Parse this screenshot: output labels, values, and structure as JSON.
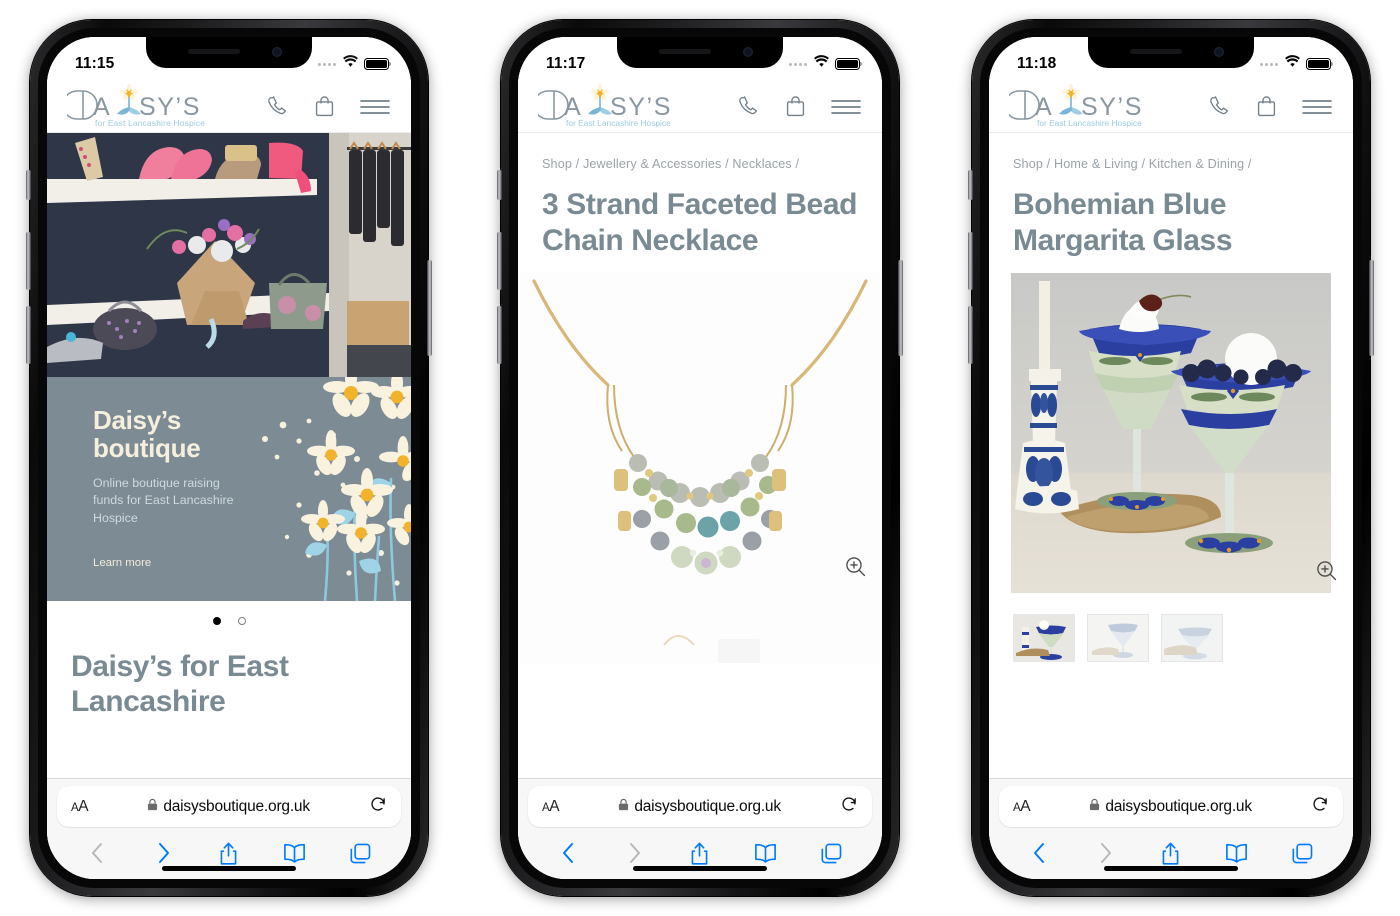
{
  "brand": {
    "logo_text": "DAISY'S",
    "logo_tagline": "for East Lancashire Hospice",
    "accent_slate": "#7c8b94",
    "accent_cream": "#f6efdd",
    "accent_blue": "#007aff",
    "logo_blue": "#79b6d6",
    "logo_gold": "#f2b225"
  },
  "phones": [
    {
      "id": "phone-home",
      "status": {
        "time": "11:15",
        "wifi": "wifi-icon",
        "battery": "battery-icon",
        "signal_dots": "signal-dots"
      },
      "header": {
        "icons": [
          "phone-icon",
          "shopping-bag-icon",
          "hamburger-menu-icon"
        ]
      },
      "hero_alt": "boutique-shop-interior-photo",
      "promo": {
        "title_line1": "Daisy’s",
        "title_line2": "boutique",
        "body": "Online boutique raising funds for East Lancashire Hospice",
        "cta": "Learn more"
      },
      "carousel": {
        "dots": 2,
        "active": 0
      },
      "headline": "Daisy’s for East Lancashire",
      "safari": {
        "aa_small": "A",
        "aa_big": "A",
        "lock": "lock-icon",
        "url": "daisysboutique.org.uk",
        "reload": "reload-icon",
        "back_enabled": false,
        "forward_enabled": true,
        "toolbar_icons": [
          "back-icon",
          "forward-icon",
          "share-icon",
          "bookmarks-icon",
          "tabs-icon"
        ]
      }
    },
    {
      "id": "phone-necklace",
      "status": {
        "time": "11:17",
        "wifi": "wifi-icon",
        "battery": "battery-icon",
        "signal_dots": "signal-dots"
      },
      "header": {
        "icons": [
          "phone-icon",
          "shopping-bag-icon",
          "hamburger-menu-icon"
        ]
      },
      "breadcrumb": "Shop / Jewellery & Accessories / Necklaces /",
      "title": "3 Strand Faceted Bead Chain Necklace",
      "product_alt": "three-strand-beaded-necklace-photo",
      "zoom_icon": "zoom-in-icon",
      "safari": {
        "aa_small": "A",
        "aa_big": "A",
        "lock": "lock-icon",
        "url": "daisysboutique.org.uk",
        "reload": "reload-icon",
        "back_enabled": true,
        "forward_enabled": false,
        "toolbar_icons": [
          "back-icon",
          "forward-icon",
          "share-icon",
          "bookmarks-icon",
          "tabs-icon"
        ]
      }
    },
    {
      "id": "phone-margarita",
      "status": {
        "time": "11:18",
        "wifi": "wifi-icon",
        "battery": "battery-icon",
        "signal_dots": "signal-dots"
      },
      "header": {
        "icons": [
          "phone-icon",
          "shopping-bag-icon",
          "hamburger-menu-icon"
        ]
      },
      "breadcrumb": "Shop / Home & Living / Kitchen & Dining /",
      "title": "Bohemian Blue Margarita Glass",
      "product_alt": "blue-bohemian-margarita-glasses-photo",
      "zoom_icon": "zoom-in-icon",
      "thumbnails": [
        "thumbnail-1",
        "thumbnail-2",
        "thumbnail-3"
      ],
      "safari": {
        "aa_small": "A",
        "aa_big": "A",
        "lock": "lock-icon",
        "url": "daisysboutique.org.uk",
        "reload": "reload-icon",
        "back_enabled": true,
        "forward_enabled": false,
        "toolbar_icons": [
          "back-icon",
          "forward-icon",
          "share-icon",
          "bookmarks-icon",
          "tabs-icon"
        ]
      }
    }
  ]
}
